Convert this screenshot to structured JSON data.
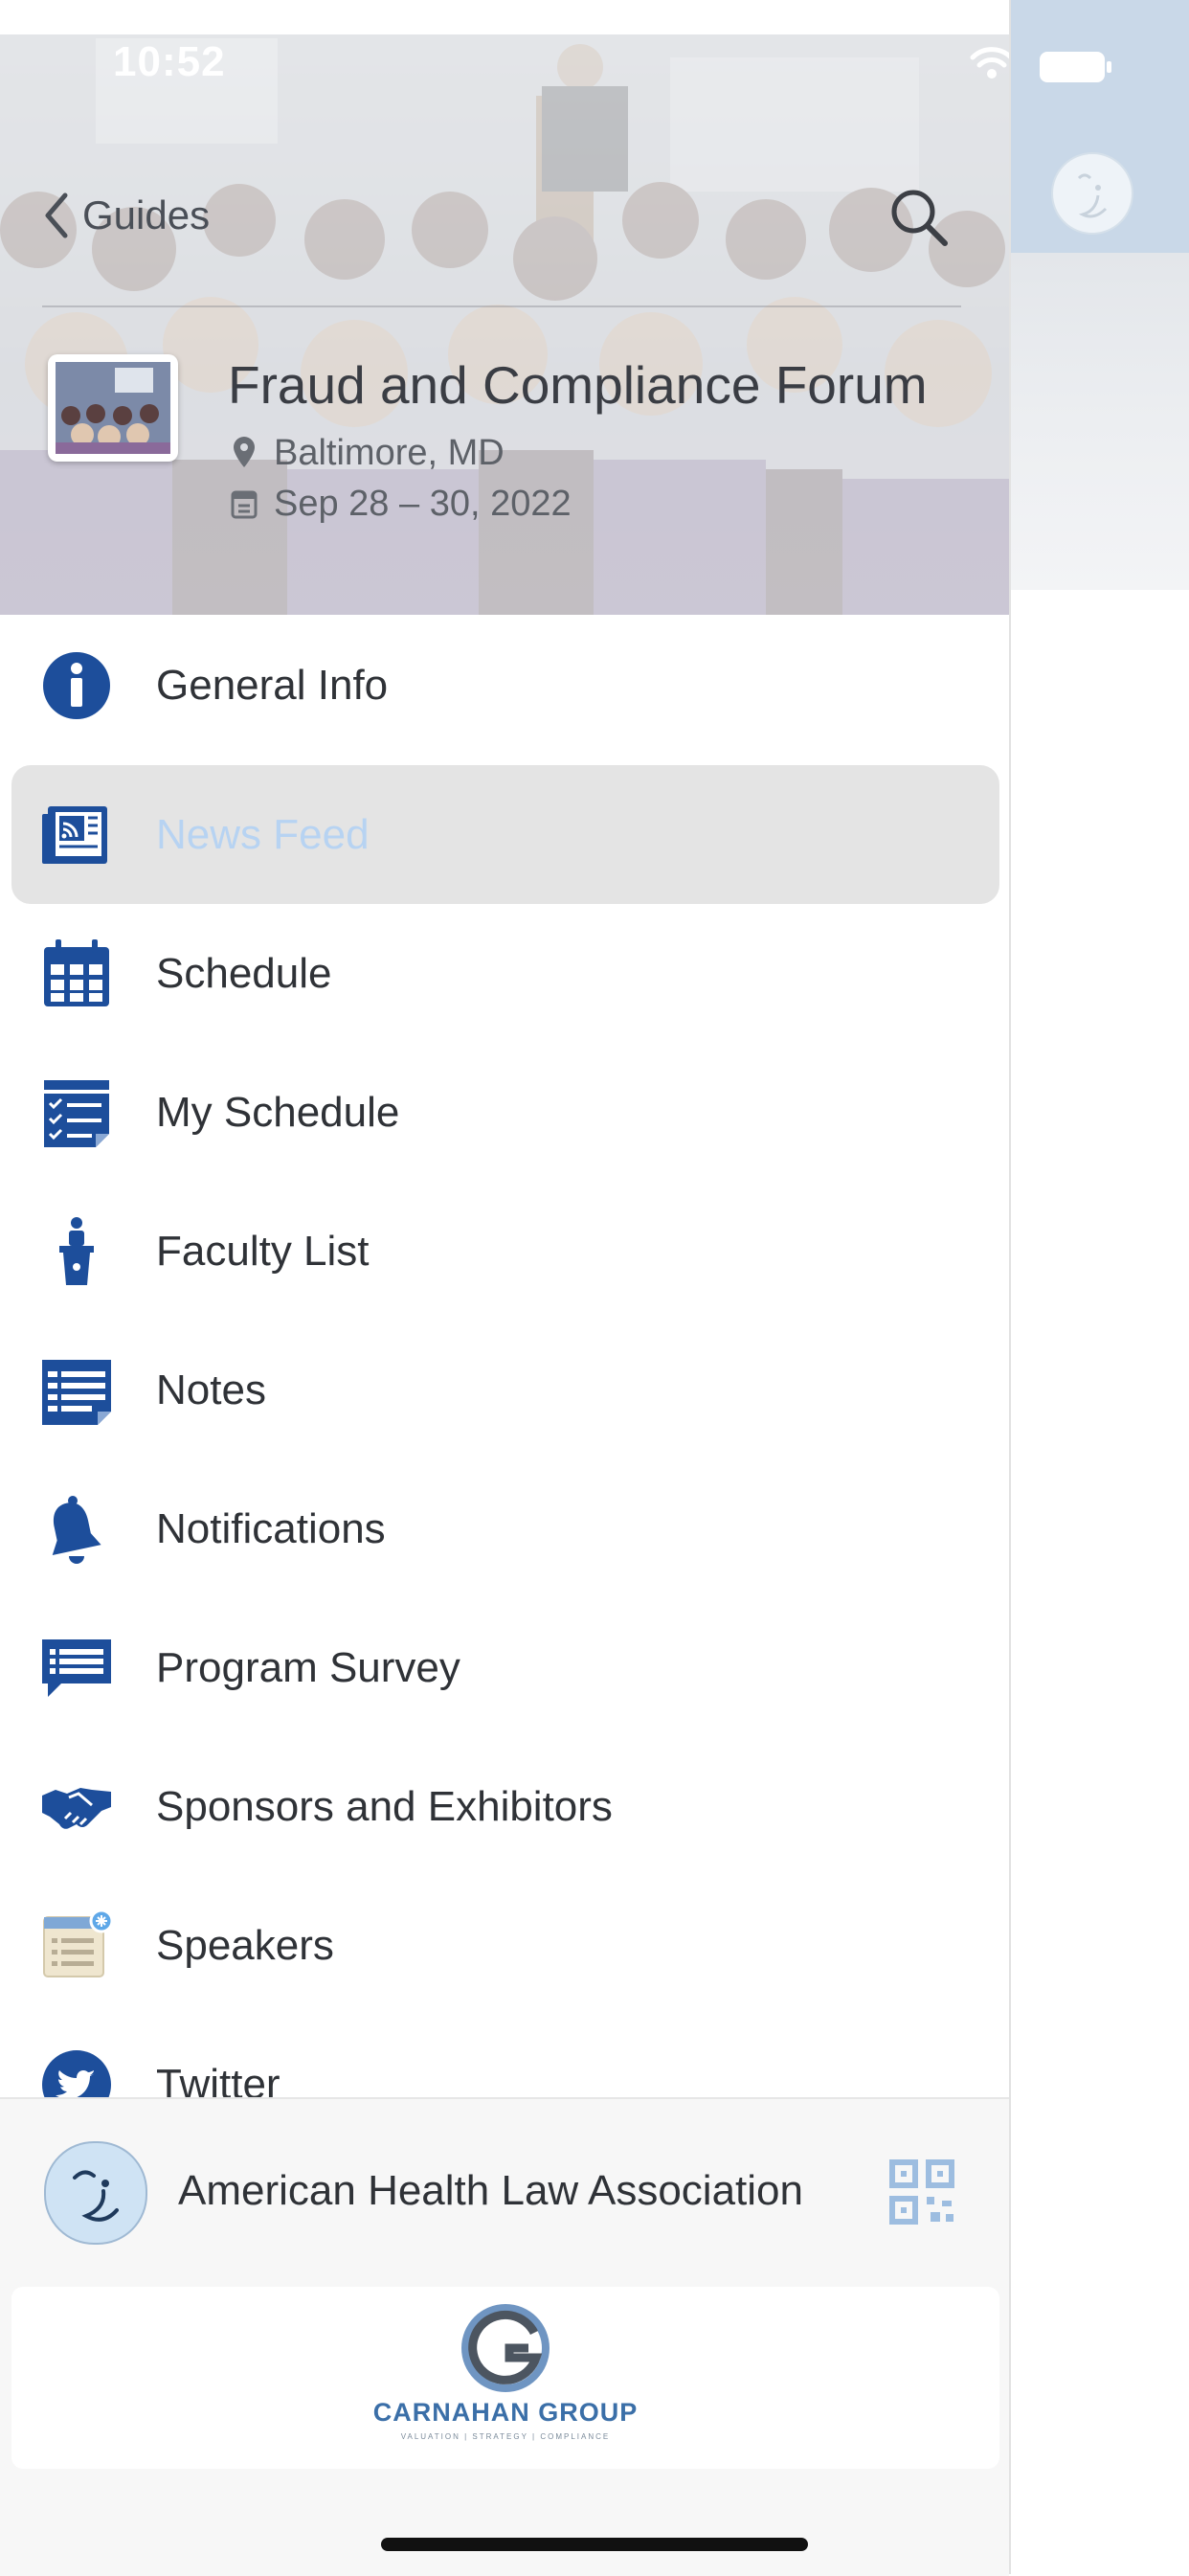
{
  "status_bar": {
    "time": "10:52"
  },
  "header": {
    "back_label": "Guides",
    "event_title": "Fraud and Compliance Forum",
    "location": "Baltimore, MD",
    "dates": "Sep 28 – 30, 2022"
  },
  "menu": {
    "items": [
      {
        "label": "General Info",
        "icon": "info-icon"
      },
      {
        "label": "News Feed",
        "icon": "news-feed-icon",
        "selected": true
      },
      {
        "label": "Schedule",
        "icon": "calendar-icon"
      },
      {
        "label": "My Schedule",
        "icon": "checklist-icon"
      },
      {
        "label": "Faculty List",
        "icon": "podium-icon"
      },
      {
        "label": "Notes",
        "icon": "notes-icon"
      },
      {
        "label": "Notifications",
        "icon": "bell-icon"
      },
      {
        "label": "Program Survey",
        "icon": "chat-list-icon"
      },
      {
        "label": "Sponsors and Exhibitors",
        "icon": "handshake-icon"
      },
      {
        "label": "Speakers",
        "icon": "speaker-list-icon"
      },
      {
        "label": "Twitter",
        "icon": "twitter-icon"
      }
    ]
  },
  "footer": {
    "org_name": "American Health Law Association",
    "sponsor_name": "CARNAHAN GROUP",
    "sponsor_tagline": "VALUATION | STRATEGY | COMPLIANCE"
  },
  "colors": {
    "brand_blue": "#1d4e9b",
    "selected_text": "#b7d3f2",
    "selected_bg": "#e4e4e4"
  }
}
